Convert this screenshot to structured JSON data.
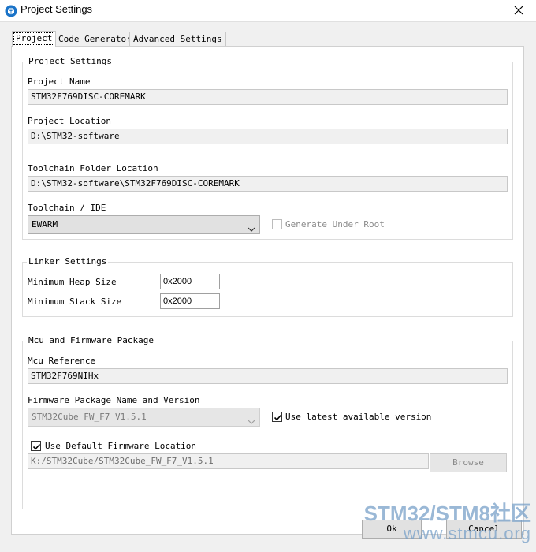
{
  "window": {
    "title": "Project Settings"
  },
  "tabs": [
    {
      "label": "Project"
    },
    {
      "label": "Code Generator"
    },
    {
      "label": "Advanced Settings"
    }
  ],
  "project_settings": {
    "title": "Project Settings",
    "project_name_label": "Project Name",
    "project_name_value": "STM32F769DISC-COREMARK",
    "project_location_label": "Project Location",
    "project_location_value": "D:\\STM32-software",
    "toolchain_folder_label": "Toolchain Folder Location",
    "toolchain_folder_value": "D:\\STM32-software\\STM32F769DISC-COREMARK",
    "toolchain_ide_label": "Toolchain / IDE",
    "toolchain_ide_value": "EWARM",
    "generate_under_root_label": "Generate Under Root",
    "generate_under_root_checked": false
  },
  "linker_settings": {
    "title": "Linker Settings",
    "min_heap_label": "Minimum Heap Size",
    "min_heap_value": "0x2000",
    "min_stack_label": "Minimum Stack Size",
    "min_stack_value": "0x2000"
  },
  "mcu_firmware": {
    "title": "Mcu and Firmware Package",
    "mcu_reference_label": "Mcu Reference",
    "mcu_reference_value": "STM32F769NIHx",
    "firmware_label": "Firmware Package Name and Version",
    "firmware_value": "STM32Cube FW_F7 V1.5.1",
    "use_latest_label": "Use latest available version",
    "use_latest_checked": true,
    "use_default_location_label": "Use Default Firmware Location",
    "use_default_location_checked": true,
    "firmware_location_value": "K:/STM32Cube/STM32Cube_FW_F7_V1.5.1",
    "browse_label": "Browse"
  },
  "footer": {
    "ok_label": "Ok",
    "cancel_label": "Cancel"
  },
  "watermark": {
    "line1": "STM32/STM8社区",
    "line2": "www.stmcu.org"
  },
  "colors": {
    "accent": "#1a73c8",
    "panel": "#f0f0f0",
    "border": "#c8c8c8"
  }
}
